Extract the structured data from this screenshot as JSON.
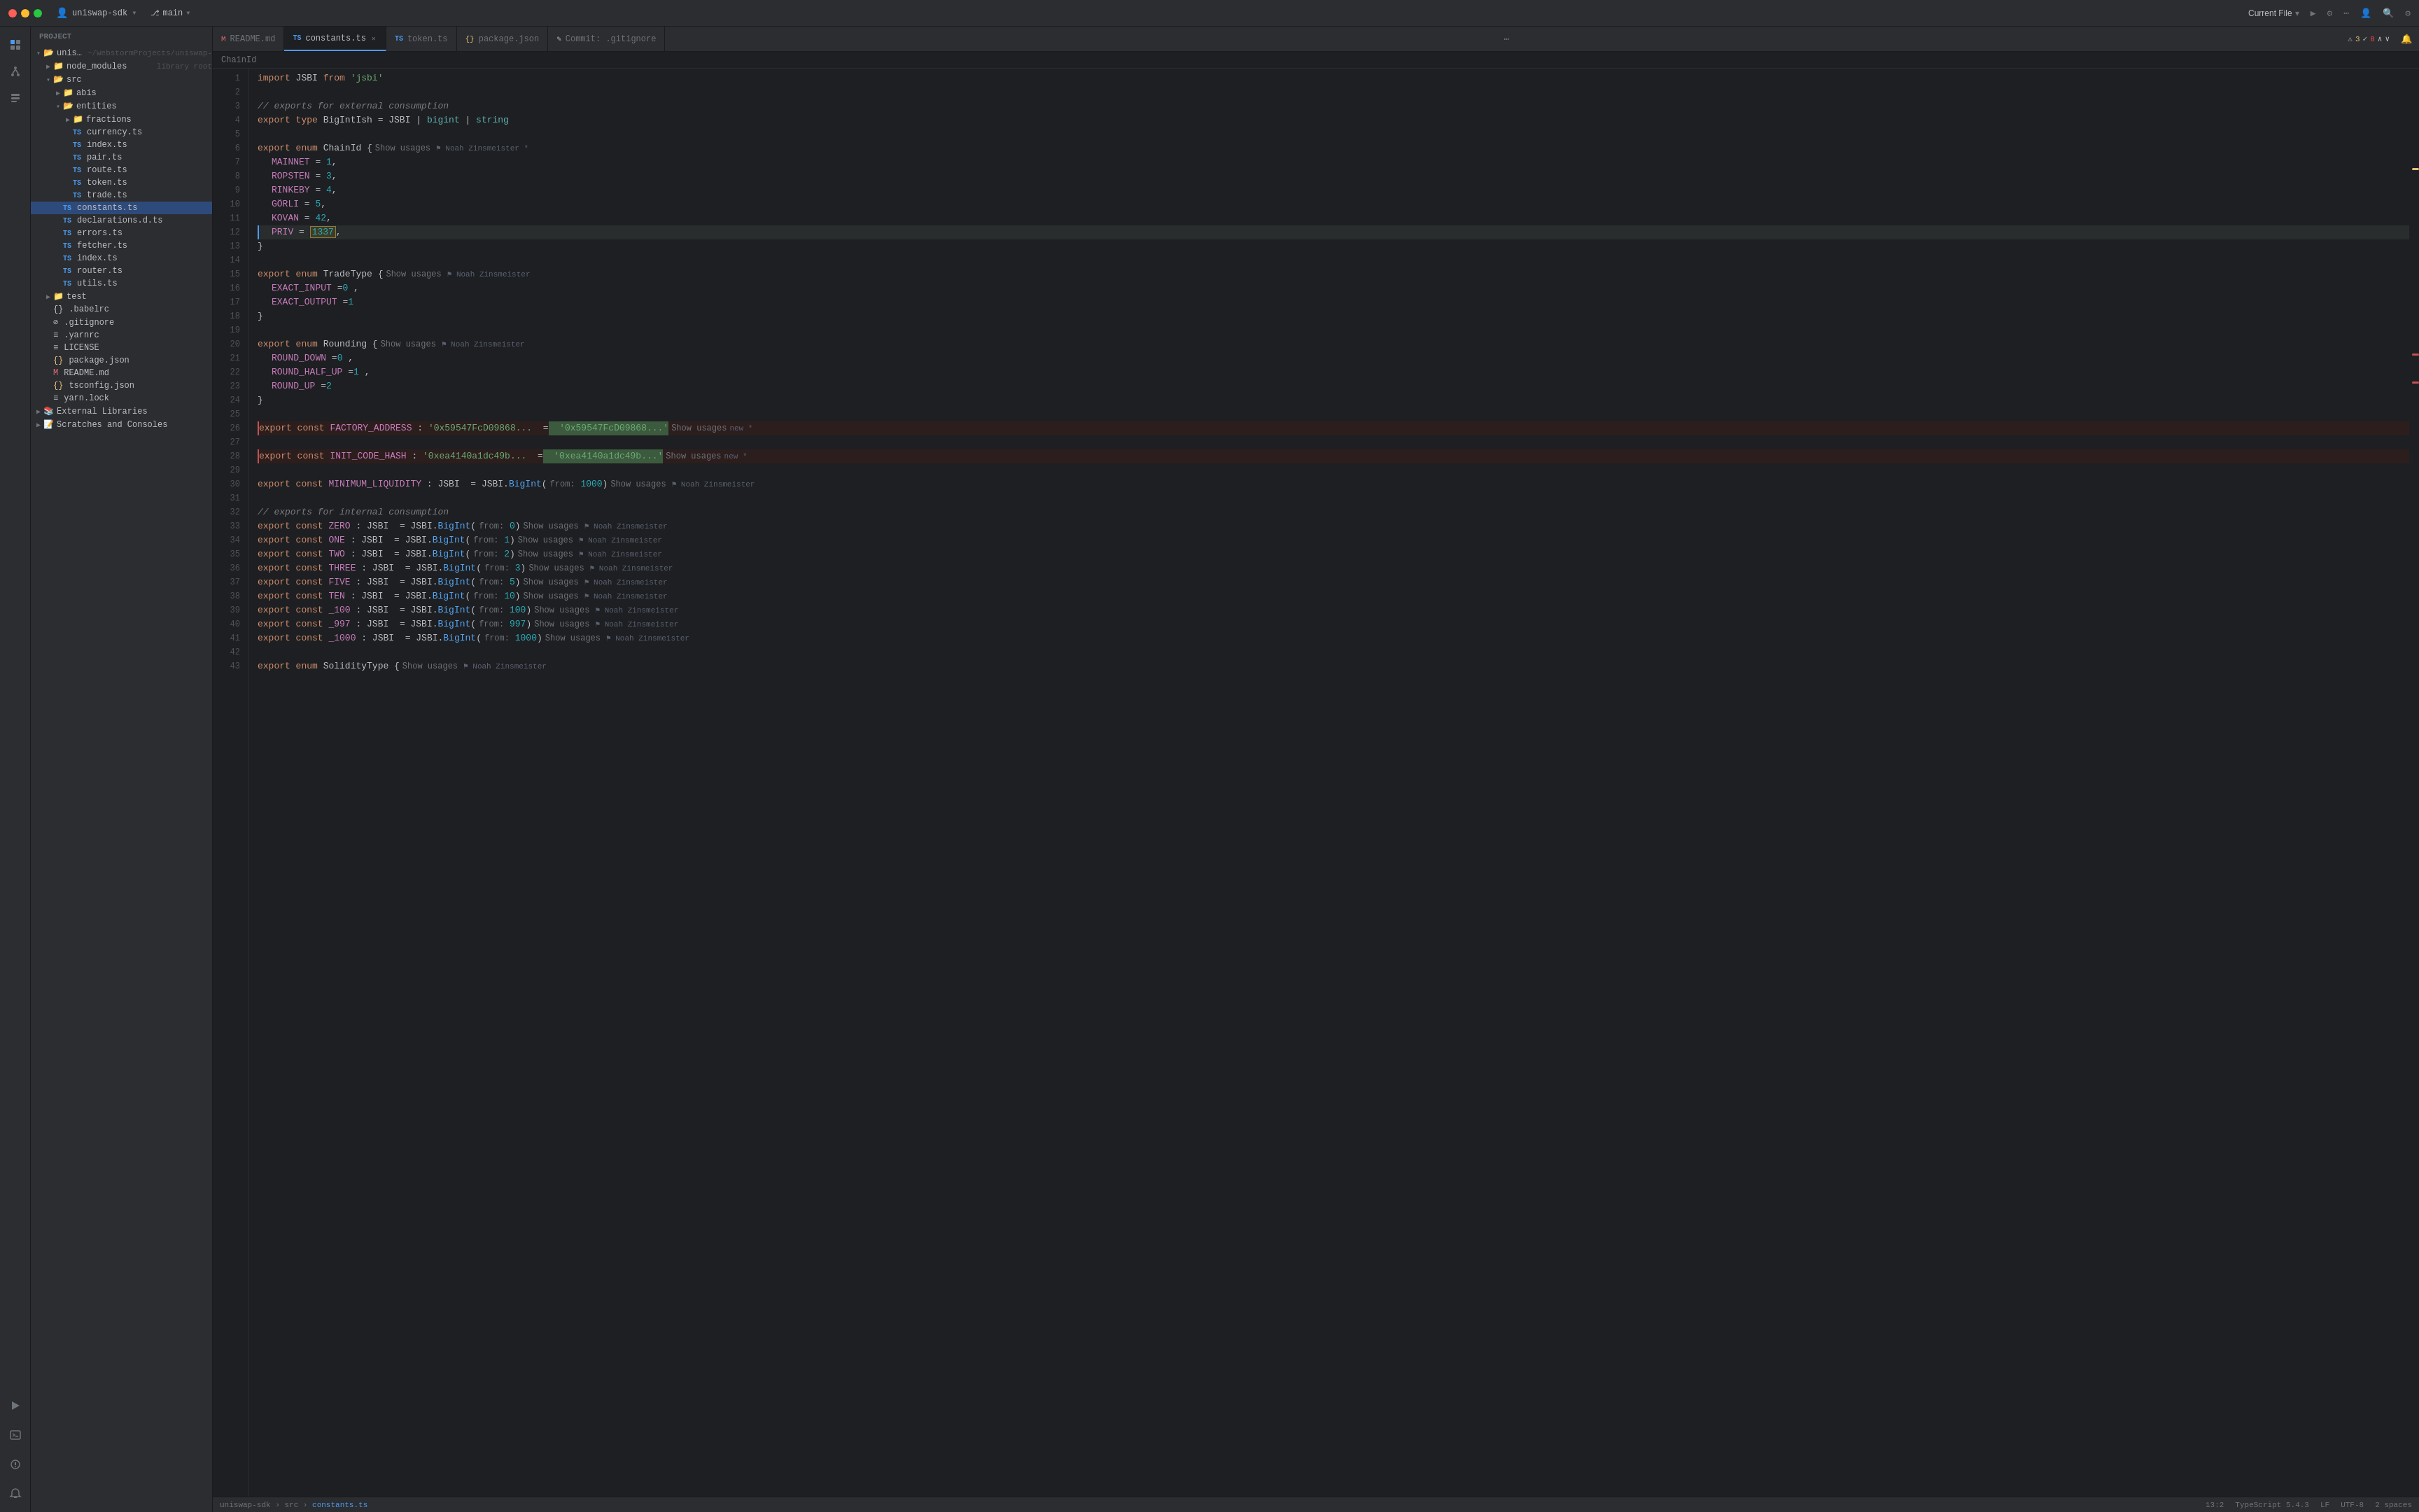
{
  "titlebar": {
    "traffic": [
      "close",
      "minimize",
      "maximize"
    ],
    "user_icon": "👤",
    "project_label": "uniswap-sdk",
    "branch_label": "main",
    "current_file_label": "Current File",
    "run_icon": "▶",
    "debug_icon": "🐞",
    "more_icon": "⋯",
    "account_icon": "👤",
    "search_icon": "🔍",
    "settings_icon": "⚙"
  },
  "tabs": [
    {
      "id": "readme",
      "label": "README.md",
      "icon": "M",
      "color": "#e06c75",
      "active": false,
      "modified": false
    },
    {
      "id": "constants",
      "label": "constants.ts",
      "icon": "TS",
      "color": "#4d9bf0",
      "active": true,
      "modified": false
    },
    {
      "id": "token",
      "label": "token.ts",
      "icon": "TS",
      "color": "#4d9bf0",
      "active": false,
      "modified": false
    },
    {
      "id": "package",
      "label": "package.json",
      "icon": "{}",
      "color": "#e5c07b",
      "active": false,
      "modified": false
    },
    {
      "id": "gitignore",
      "label": "Commit: .gitignore",
      "icon": "✎",
      "color": "#bcbec4",
      "active": false,
      "modified": false
    }
  ],
  "editor": {
    "warnings": "3",
    "errors": "8",
    "lines": [
      {
        "n": 1,
        "code": "import JSBI from 'jsbi'"
      },
      {
        "n": 2,
        "code": ""
      },
      {
        "n": 3,
        "code": "// exports for external consumption"
      },
      {
        "n": 4,
        "code": "export type BigIntIsh = JSBI | bigint | string"
      },
      {
        "n": 5,
        "code": ""
      },
      {
        "n": 6,
        "code": "export enum ChainId {  Show usages  ⚑ Noah Zinsmeister *"
      },
      {
        "n": 7,
        "code": "  MAINNET = 1,"
      },
      {
        "n": 8,
        "code": "  ROPSTEN = 3,"
      },
      {
        "n": 9,
        "code": "  RINKEBY = 4,"
      },
      {
        "n": 10,
        "code": "  GÖRLI = 5,"
      },
      {
        "n": 11,
        "code": "  KOVAN = 42,"
      },
      {
        "n": 12,
        "code": "  PRIV = 1337,",
        "current": true
      },
      {
        "n": 13,
        "code": "}"
      },
      {
        "n": 14,
        "code": ""
      },
      {
        "n": 15,
        "code": "export enum TradeType {  Show usages  ⚑ Noah Zinsmeister"
      },
      {
        "n": 16,
        "code": "  EXACT_INPUT = 0 ,"
      },
      {
        "n": 17,
        "code": "  EXACT_OUTPUT = 1"
      },
      {
        "n": 18,
        "code": "}"
      },
      {
        "n": 19,
        "code": ""
      },
      {
        "n": 20,
        "code": "export enum Rounding {  Show usages  ⚑ Noah Zinsmeister"
      },
      {
        "n": 21,
        "code": "  ROUND_DOWN = 0 ,"
      },
      {
        "n": 22,
        "code": "  ROUND_HALF_UP = 1 ,"
      },
      {
        "n": 23,
        "code": "  ROUND_UP = 2"
      },
      {
        "n": 24,
        "code": "}"
      },
      {
        "n": 25,
        "code": ""
      },
      {
        "n": 26,
        "code": "export const FACTORY_ADDRESS : '0x59547FcD09868...  = '0x59547FcD09868...'  Show usages  new *",
        "boxed": true
      },
      {
        "n": 27,
        "code": ""
      },
      {
        "n": 28,
        "code": "export const INIT_CODE_HASH : '0xea4140a1dc49b...  = '0xea4140a1dc49b...'  Show usages  new *",
        "boxed": true
      },
      {
        "n": 29,
        "code": ""
      },
      {
        "n": 30,
        "code": "export const MINIMUM_LIQUIDITY : JSBI  = JSBI.BigInt( from: 1000)  Show usages  ⚑ Noah Zinsmeister"
      },
      {
        "n": 31,
        "code": ""
      },
      {
        "n": 32,
        "code": "// exports for internal consumption"
      },
      {
        "n": 33,
        "code": "export const ZERO : JSBI  = JSBI.BigInt( from: 0)  Show usages  ⚑ Noah Zinsmeister"
      },
      {
        "n": 34,
        "code": "export const ONE : JSBI  = JSBI.BigInt( from: 1)  Show usages  ⚑ Noah Zinsmeister"
      },
      {
        "n": 35,
        "code": "export const TWO : JSBI  = JSBI.BigInt( from: 2)  Show usages  ⚑ Noah Zinsmeister"
      },
      {
        "n": 36,
        "code": "export const THREE : JSBI  = JSBI.BigInt( from: 3)  Show usages  ⚑ Noah Zinsmeister"
      },
      {
        "n": 37,
        "code": "export const FIVE : JSBI  = JSBI.BigInt( from: 5)  Show usages  ⚑ Noah Zinsmeister"
      },
      {
        "n": 38,
        "code": "export const TEN : JSBI  = JSBI.BigInt( from: 10)  Show usages  ⚑ Noah Zinsmeister"
      },
      {
        "n": 39,
        "code": "export const _100 : JSBI  = JSBI.BigInt( from: 100)  Show usages  ⚑ Noah Zinsmeister"
      },
      {
        "n": 40,
        "code": "export const _997 : JSBI  = JSBI.BigInt( from: 997)  Show usages  ⚑ Noah Zinsmeister"
      },
      {
        "n": 41,
        "code": "export const _1000 : JSBI  = JSBI.BigInt( from: 1000)  Show usages  ⚑ Noah Zinsmeister"
      },
      {
        "n": 42,
        "code": ""
      },
      {
        "n": 43,
        "code": "export enum SolidityType {  Show usages  ⚑ Noah Zinsmeister"
      }
    ]
  },
  "sidebar": {
    "icons": [
      {
        "id": "folder",
        "symbol": "📁",
        "active": true
      },
      {
        "id": "git",
        "symbol": "⎇",
        "active": false
      },
      {
        "id": "structure",
        "symbol": "⊞",
        "active": false
      },
      {
        "id": "more",
        "symbol": "⋯",
        "active": false
      }
    ],
    "bottom_icons": [
      {
        "id": "run",
        "symbol": "▶"
      },
      {
        "id": "debug",
        "symbol": "🐛"
      },
      {
        "id": "terminal",
        "symbol": "⌘"
      },
      {
        "id": "notifications",
        "symbol": "🔔"
      }
    ]
  },
  "file_tree": {
    "project_label": "Project",
    "items": [
      {
        "id": "uniswap-sdk-root",
        "label": "uniswap-sdk",
        "indent": 0,
        "type": "folder",
        "expanded": true,
        "suffix": "~/WebstormProjects/uniswap-"
      },
      {
        "id": "node_modules",
        "label": "node_modules",
        "indent": 1,
        "type": "folder",
        "expanded": false,
        "suffix": "library root"
      },
      {
        "id": "src",
        "label": "src",
        "indent": 1,
        "type": "folder",
        "expanded": true
      },
      {
        "id": "abis",
        "label": "abis",
        "indent": 2,
        "type": "folder",
        "expanded": false
      },
      {
        "id": "entities",
        "label": "entities",
        "indent": 2,
        "type": "folder",
        "expanded": true
      },
      {
        "id": "fractions",
        "label": "fractions",
        "indent": 3,
        "type": "folder",
        "expanded": false
      },
      {
        "id": "currency-ts",
        "label": "currency.ts",
        "indent": 3,
        "type": "ts"
      },
      {
        "id": "index-ts",
        "label": "index.ts",
        "indent": 3,
        "type": "ts"
      },
      {
        "id": "pair-ts",
        "label": "pair.ts",
        "indent": 3,
        "type": "ts"
      },
      {
        "id": "route-ts",
        "label": "route.ts",
        "indent": 3,
        "type": "ts"
      },
      {
        "id": "token-ts",
        "label": "token.ts",
        "indent": 3,
        "type": "ts"
      },
      {
        "id": "trade-ts",
        "label": "trade.ts",
        "indent": 3,
        "type": "ts"
      },
      {
        "id": "constants-ts",
        "label": "constants.ts",
        "indent": 2,
        "type": "ts",
        "selected": true
      },
      {
        "id": "declarations-d-ts",
        "label": "declarations.d.ts",
        "indent": 2,
        "type": "ts"
      },
      {
        "id": "errors-ts",
        "label": "errors.ts",
        "indent": 2,
        "type": "ts"
      },
      {
        "id": "fetcher-ts",
        "label": "fetcher.ts",
        "indent": 2,
        "type": "ts"
      },
      {
        "id": "index2-ts",
        "label": "index.ts",
        "indent": 2,
        "type": "ts"
      },
      {
        "id": "router-ts",
        "label": "router.ts",
        "indent": 2,
        "type": "ts"
      },
      {
        "id": "utils-ts",
        "label": "utils.ts",
        "indent": 2,
        "type": "ts"
      },
      {
        "id": "test",
        "label": "test",
        "indent": 1,
        "type": "folder",
        "expanded": false
      },
      {
        "id": "babelrc",
        "label": ".babelrc",
        "indent": 1,
        "type": "config"
      },
      {
        "id": "gitignore",
        "label": ".gitignore",
        "indent": 1,
        "type": "config"
      },
      {
        "id": "yarnrc",
        "label": ".yarnrc",
        "indent": 1,
        "type": "config"
      },
      {
        "id": "LICENSE",
        "label": "LICENSE",
        "indent": 1,
        "type": "file"
      },
      {
        "id": "package-json",
        "label": "package.json",
        "indent": 1,
        "type": "json"
      },
      {
        "id": "readme-md",
        "label": "README.md",
        "indent": 1,
        "type": "md"
      },
      {
        "id": "tsconfig-json",
        "label": "tsconfig.json",
        "indent": 1,
        "type": "json"
      },
      {
        "id": "yarn-lock",
        "label": "yarn.lock",
        "indent": 1,
        "type": "file"
      },
      {
        "id": "external-libraries",
        "label": "External Libraries",
        "indent": 0,
        "type": "folder",
        "expanded": false
      },
      {
        "id": "scratches",
        "label": "Scratches and Consoles",
        "indent": 0,
        "type": "folder",
        "expanded": false
      }
    ]
  },
  "status_bar": {
    "project": "uniswap-sdk",
    "path": "src > constants.ts",
    "position": "13:2",
    "lang": "TypeScript 5.4.3",
    "line_sep": "LF",
    "encoding": "UTF-8",
    "indent": "2 spaces"
  },
  "breadcrumb": {
    "text": "ChainId"
  }
}
